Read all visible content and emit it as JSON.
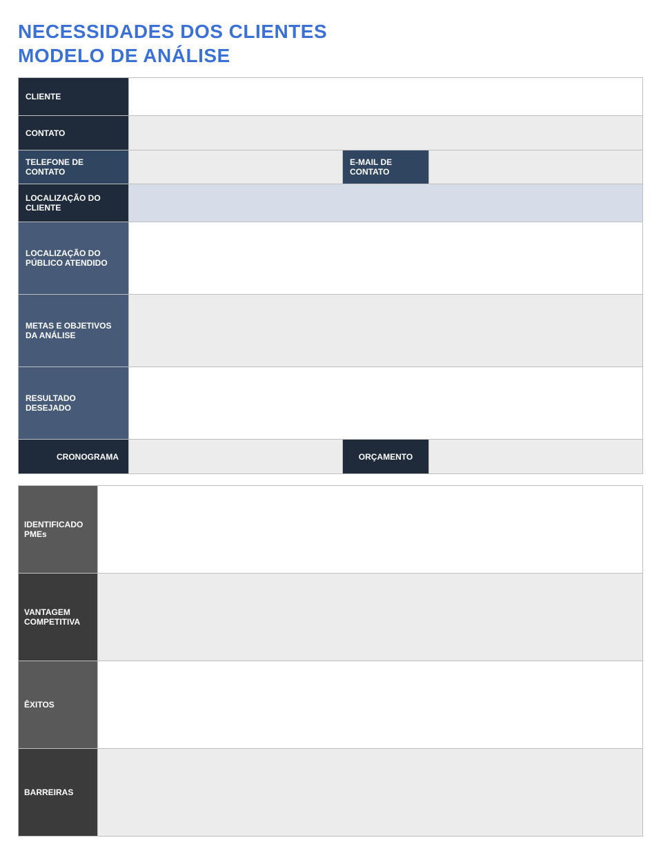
{
  "title_line1": "NECESSIDADES DOS CLIENTES",
  "title_line2": "MODELO DE ANÁLISE",
  "section1": {
    "cliente_label": "CLIENTE",
    "cliente_value": "",
    "contato_label": "CONTATO",
    "contato_value": "",
    "telefone_label": "TELEFONE DE CONTATO",
    "telefone_value": "",
    "email_label": "E-MAIL DE CONTATO",
    "email_value": "",
    "loc_cliente_label": "LOCALIZAÇÃO DO CLIENTE",
    "loc_cliente_value": "",
    "loc_publico_label": "LOCALIZAÇÃO DO PÚBLICO ATENDIDO",
    "loc_publico_value": "",
    "metas_label": "METAS E OBJETIVOS DA ANÁLISE",
    "metas_value": "",
    "resultado_label": "RESULTADO DESEJADO",
    "resultado_value": "",
    "cronograma_label": "CRONOGRAMA",
    "cronograma_value": "",
    "orcamento_label": "ORÇAMENTO",
    "orcamento_value": ""
  },
  "section2": {
    "pmes_label": "IDENTIFICADO PMEs",
    "pmes_value": "",
    "vantagem_label": "VANTAGEM COMPETITIVA",
    "vantagem_value": "",
    "exitos_label": "ÊXITOS",
    "exitos_value": "",
    "barreiras_label": "BARREIRAS",
    "barreiras_value": ""
  }
}
